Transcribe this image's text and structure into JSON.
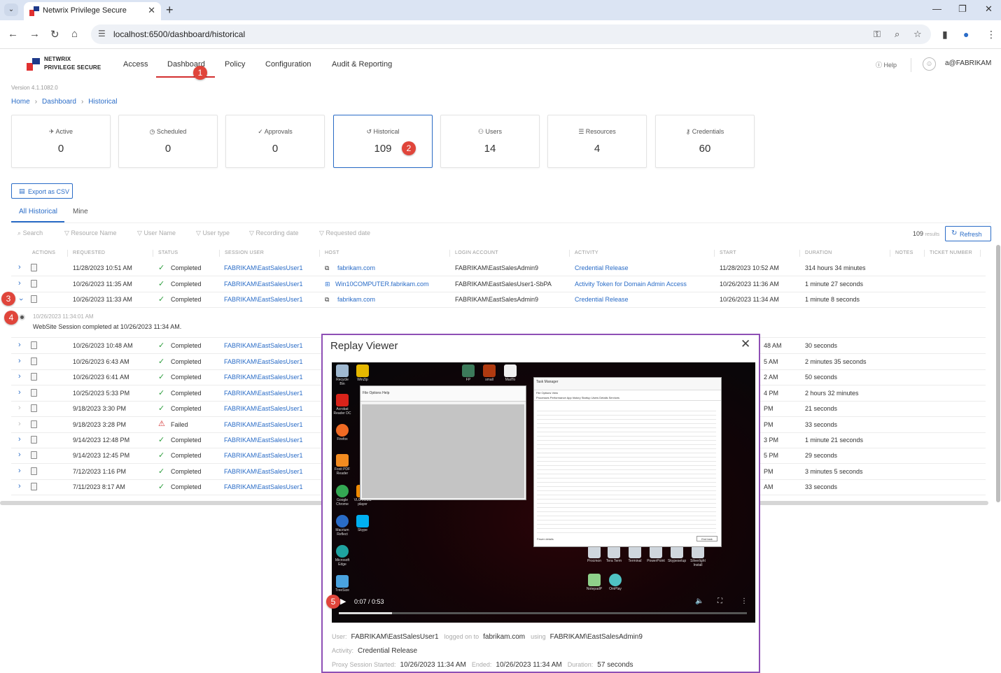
{
  "browser": {
    "tab_title": "Netwrix Privilege Secure",
    "url": "localhost:6500/dashboard/historical"
  },
  "app": {
    "logo_line1": "NETWRIX",
    "logo_line2": "PRIVILEGE SECURE",
    "nav": [
      "Access",
      "Dashboard",
      "Policy",
      "Configuration",
      "Audit & Reporting"
    ],
    "active_nav": "Dashboard",
    "help": "Help",
    "user": "a@FABRIKAM",
    "version": "Version 4.1.1082.0"
  },
  "breadcrumb": [
    "Home",
    "Dashboard",
    "Historical"
  ],
  "cards": [
    {
      "label": "Active",
      "value": "0",
      "icon": "running-icon"
    },
    {
      "label": "Scheduled",
      "value": "0",
      "icon": "clock-icon"
    },
    {
      "label": "Approvals",
      "value": "0",
      "icon": "check-icon"
    },
    {
      "label": "Historical",
      "value": "109",
      "icon": "history-icon"
    },
    {
      "label": "Users",
      "value": "14",
      "icon": "user-icon"
    },
    {
      "label": "Resources",
      "value": "4",
      "icon": "server-icon"
    },
    {
      "label": "Credentials",
      "value": "60",
      "icon": "key-icon"
    }
  ],
  "export_label": "Export as CSV",
  "subtabs": [
    "All Historical",
    "Mine"
  ],
  "filters": {
    "search": "Search",
    "resource_name": "Resource Name",
    "user_name": "User Name",
    "user_type": "User type",
    "recording_date": "Recording date",
    "requested_date": "Requested date"
  },
  "results_count": "109",
  "results_label": "results",
  "refresh_label": "Refresh",
  "columns": [
    "ACTIONS",
    "REQUESTED",
    "STATUS",
    "SESSION USER",
    "HOST",
    "LOGIN ACCOUNT",
    "ACTIVITY",
    "START",
    "DURATION",
    "NOTES",
    "TICKET NUMBER"
  ],
  "rows": [
    {
      "requested": "11/28/2023 10:51 AM",
      "status": "Completed",
      "user": "FABRIKAM\\EastSalesUser1",
      "host": "fabrikam.com",
      "login": "FABRIKAM\\EastSalesAdmin9",
      "activity": "Credential Release",
      "start": "11/28/2023 10:52 AM",
      "duration": "314 hours 34 minutes"
    },
    {
      "requested": "10/26/2023 11:35 AM",
      "status": "Completed",
      "user": "FABRIKAM\\EastSalesUser1",
      "host": "Win10COMPUTER.fabrikam.com",
      "login": "FABRIKAM\\EastSalesUser1-SbPA",
      "activity": "Activity Token for Domain Admin Access",
      "start": "10/26/2023 11:36 AM",
      "duration": "1 minute 27 seconds"
    },
    {
      "requested": "10/26/2023 11:33 AM",
      "status": "Completed",
      "user": "FABRIKAM\\EastSalesUser1",
      "host": "fabrikam.com",
      "login": "FABRIKAM\\EastSalesAdmin9",
      "activity": "Credential Release",
      "start": "10/26/2023 11:34 AM",
      "duration": "1 minute 8 seconds"
    },
    {
      "requested": "10/26/2023 10:48 AM",
      "status": "Completed",
      "user": "FABRIKAM\\EastSalesUser1",
      "start": "48 AM",
      "duration": "30 seconds"
    },
    {
      "requested": "10/26/2023 6:43 AM",
      "status": "Completed",
      "user": "FABRIKAM\\EastSalesUser1",
      "start": "5 AM",
      "duration": "2 minutes 35 seconds"
    },
    {
      "requested": "10/26/2023 6:41 AM",
      "status": "Completed",
      "user": "FABRIKAM\\EastSalesUser1",
      "start": "2 AM",
      "duration": "50 seconds"
    },
    {
      "requested": "10/25/2023 5:33 PM",
      "status": "Completed",
      "user": "FABRIKAM\\EastSalesUser1",
      "start": "4 PM",
      "duration": "2 hours 32 minutes"
    },
    {
      "requested": "9/18/2023 3:30 PM",
      "status": "Completed",
      "user": "FABRIKAM\\EastSalesUser1",
      "start": "PM",
      "duration": "21 seconds"
    },
    {
      "requested": "9/18/2023 3:28 PM",
      "status": "Failed",
      "user": "FABRIKAM\\EastSalesUser1",
      "start": "PM",
      "duration": "33 seconds"
    },
    {
      "requested": "9/14/2023 12:48 PM",
      "status": "Completed",
      "user": "FABRIKAM\\EastSalesUser1",
      "start": "3 PM",
      "duration": "1 minute 21 seconds"
    },
    {
      "requested": "9/14/2023 12:45 PM",
      "status": "Completed",
      "user": "FABRIKAM\\EastSalesUser1",
      "start": "5 PM",
      "duration": "29 seconds"
    },
    {
      "requested": "7/12/2023 1:16 PM",
      "status": "Completed",
      "user": "FABRIKAM\\EastSalesUser1",
      "start": "PM",
      "duration": "3 minutes 5 seconds"
    },
    {
      "requested": "7/11/2023 8:17 AM",
      "status": "Completed",
      "user": "FABRIKAM\\EastSalesUser1",
      "start": "AM",
      "duration": "33 seconds"
    }
  ],
  "detail": {
    "time": "10/26/2023 11:34:01 AM",
    "message": "WebSite Session completed at 10/26/2023 11:34 AM."
  },
  "markers": [
    "1",
    "2",
    "3",
    "4",
    "5"
  ],
  "replay": {
    "title": "Replay Viewer",
    "time": "0:07 / 0:53",
    "progress_fraction": 0.13,
    "user_key": "User:",
    "user": "FABRIKAM\\EastSalesUser1",
    "logged_on_key": "logged on to",
    "host": "fabrikam.com",
    "using_key": "using",
    "account": "FABRIKAM\\EastSalesAdmin9",
    "activity_key": "Activity:",
    "activity": "Credential Release",
    "started_key": "Proxy Session Started:",
    "started": "10/26/2023 11:34 AM",
    "ended_key": "Ended:",
    "ended": "10/26/2023 11:34 AM",
    "duration_key": "Duration:",
    "duration": "57 seconds",
    "desktop_icons": [
      "Recycle Bin",
      "WinZip",
      "Acrobat Reader DC",
      "Firefox",
      "Foxit PDF Reader",
      "Google Chrome",
      "VLC media player",
      "Macrium Reflect",
      "Skype",
      "Microsoft Edge",
      "TreeSize",
      "FP",
      "small",
      "MailTo",
      "Procmon",
      "Tera Term",
      "Terminal",
      "PowerPoint",
      "Skypesetup",
      "Silverlight Install",
      "NotepadP",
      "OmPlay"
    ],
    "taskmgr_title": "Task Manager",
    "taskmgr_menu": "File  Options  View",
    "taskmgr_tabs": "Processes  Performance  App history  Startup  Users  Details  Services",
    "fewer_details": "Fewer details",
    "end_task": "End task",
    "window_a_menu": "File  Options  Help"
  }
}
